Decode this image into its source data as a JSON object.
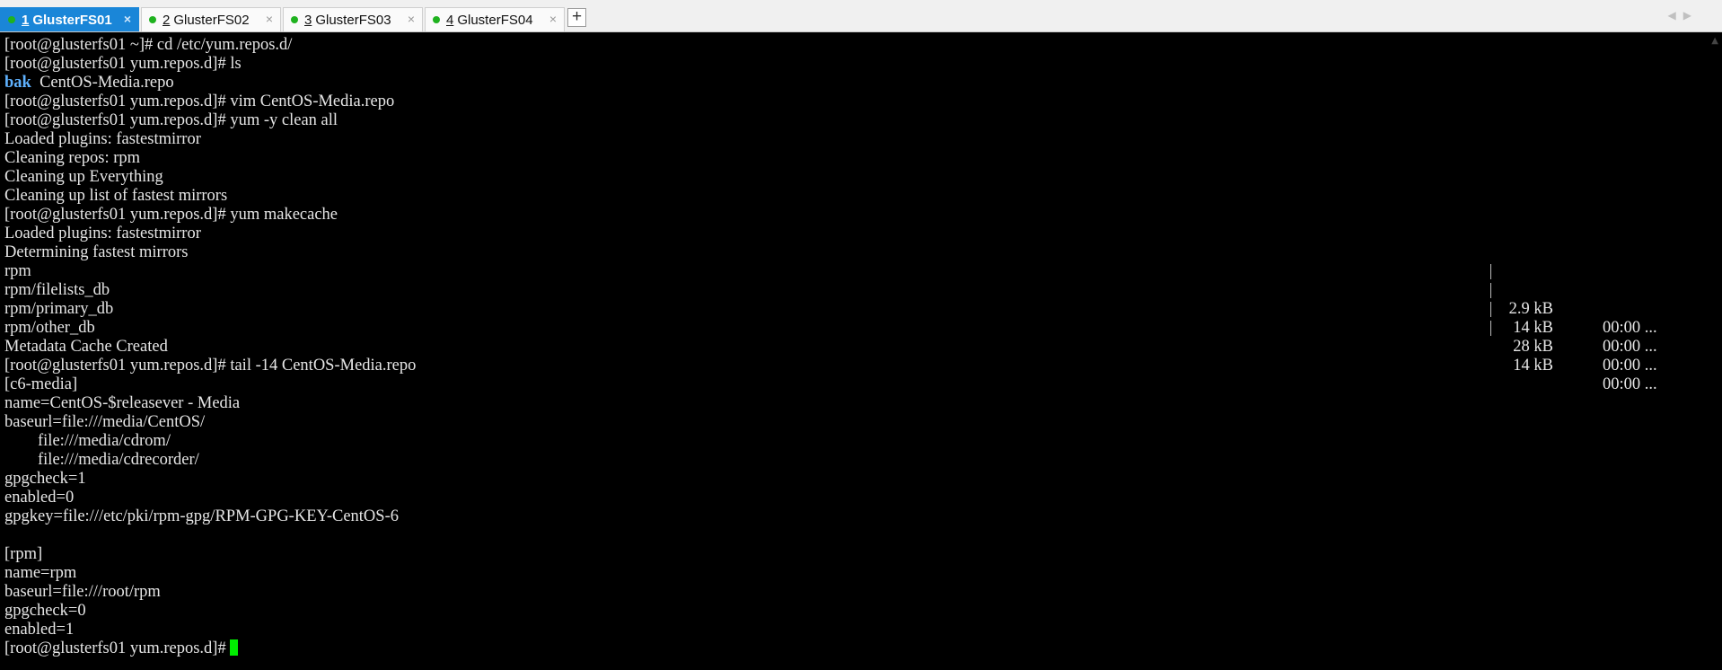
{
  "tabs": [
    {
      "number": "1",
      "label": "GlusterFS01",
      "active": true
    },
    {
      "number": "2",
      "label": "GlusterFS02",
      "active": false
    },
    {
      "number": "3",
      "label": "GlusterFS03",
      "active": false
    },
    {
      "number": "4",
      "label": "GlusterFS04",
      "active": false
    }
  ],
  "tab_close_glyph": "×",
  "add_tab_glyph": "+",
  "nav_glyphs": "◀▶",
  "colors": {
    "active_tab": "#1a86d8",
    "status_dot": "#1fb21f",
    "cursor": "#00ee00",
    "directory": "#5fb2ff"
  },
  "terminal": {
    "lines": [
      "[root@glusterfs01 ~]# cd /etc/yum.repos.d/",
      "[root@glusterfs01 yum.repos.d]# ls",
      "",
      "[root@glusterfs01 yum.repos.d]# vim CentOS-Media.repo",
      "[root@glusterfs01 yum.repos.d]# yum -y clean all",
      "Loaded plugins: fastestmirror",
      "Cleaning repos: rpm",
      "Cleaning up Everything",
      "Cleaning up list of fastest mirrors",
      "[root@glusterfs01 yum.repos.d]# yum makecache",
      "Loaded plugins: fastestmirror",
      "Determining fastest mirrors",
      "rpm",
      "rpm/filelists_db",
      "rpm/primary_db",
      "rpm/other_db",
      "Metadata Cache Created",
      "[root@glusterfs01 yum.repos.d]# tail -14 CentOS-Media.repo",
      "[c6-media]",
      "name=CentOS-$releasever - Media",
      "baseurl=file:///media/CentOS/",
      "        file:///media/cdrom/",
      "        file:///media/cdrecorder/",
      "gpgcheck=1",
      "enabled=0",
      "gpgkey=file:///etc/pki/rpm-gpg/RPM-GPG-KEY-CentOS-6",
      "",
      "[rpm]",
      "name=rpm",
      "baseurl=file:///root/rpm",
      "gpgcheck=0",
      "enabled=1",
      "[root@glusterfs01 yum.repos.d]# "
    ],
    "ls_output": {
      "dir": "bak",
      "file": "  CentOS-Media.repo"
    },
    "downloads": [
      {
        "size": "2.9 kB",
        "time": "00:00 ..."
      },
      {
        "size": "14 kB",
        "time": "00:00 ..."
      },
      {
        "size": "28 kB",
        "time": "00:00 ..."
      },
      {
        "size": "14 kB",
        "time": "00:00 ..."
      }
    ]
  }
}
